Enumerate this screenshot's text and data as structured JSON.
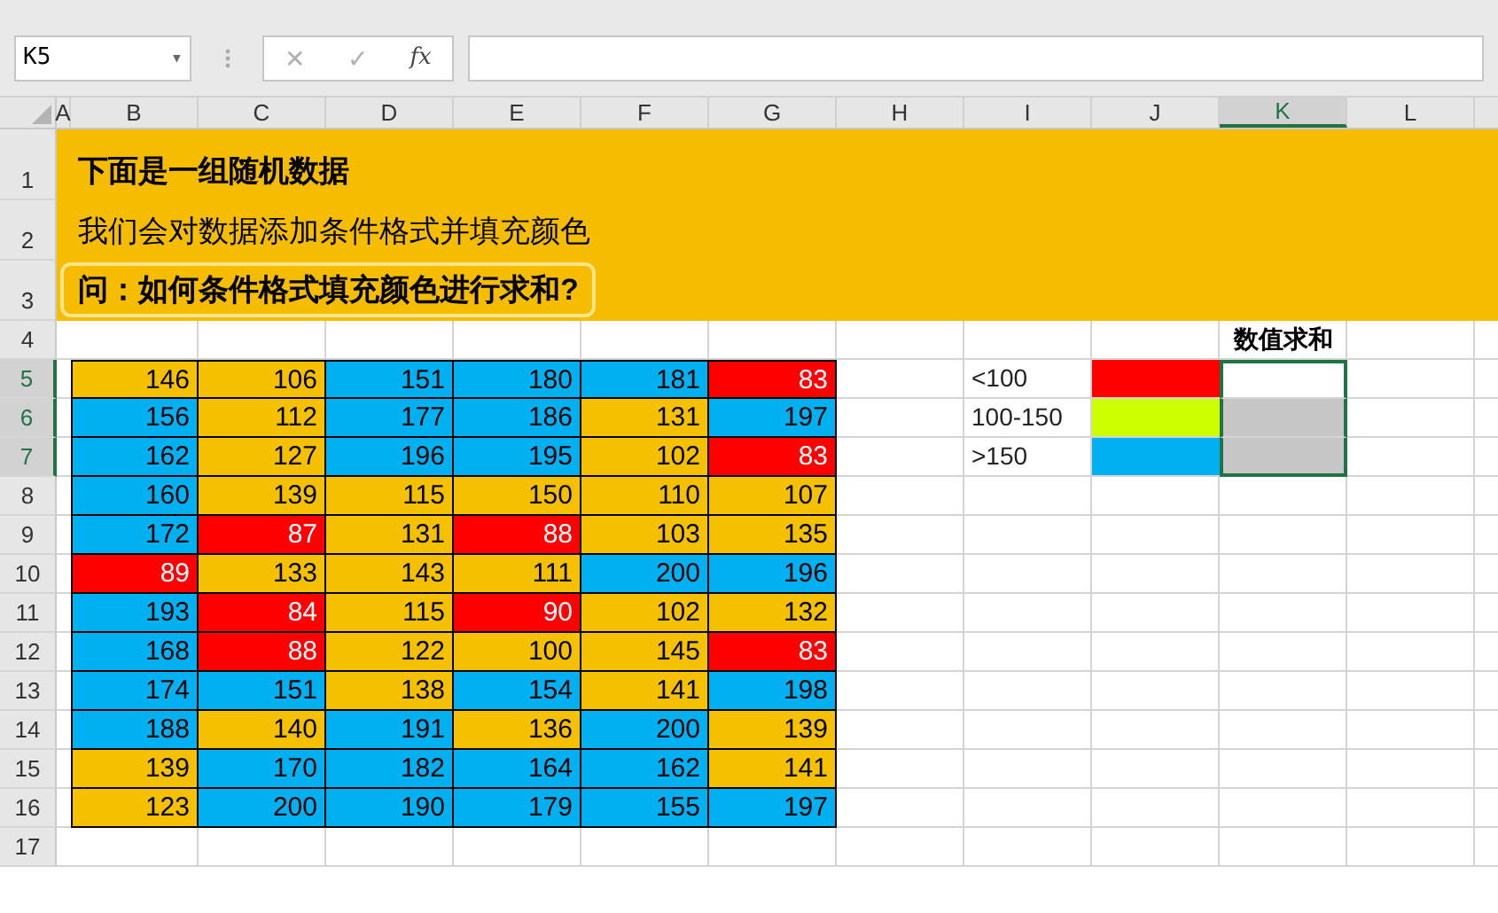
{
  "name_box": {
    "value": "K5",
    "caret": "▾"
  },
  "formula_bar": {
    "cancel": "✕",
    "enter": "✓",
    "function": "fx"
  },
  "columns": [
    {
      "label": "A",
      "selected": false
    },
    {
      "label": "B",
      "selected": false
    },
    {
      "label": "C",
      "selected": false
    },
    {
      "label": "D",
      "selected": false
    },
    {
      "label": "E",
      "selected": false
    },
    {
      "label": "F",
      "selected": false
    },
    {
      "label": "G",
      "selected": false
    },
    {
      "label": "H",
      "selected": false
    },
    {
      "label": "I",
      "selected": false
    },
    {
      "label": "J",
      "selected": false
    },
    {
      "label": "K",
      "selected": true
    },
    {
      "label": "L",
      "selected": false
    }
  ],
  "row_numbers": [
    {
      "label": "1",
      "selected": false
    },
    {
      "label": "2",
      "selected": false
    },
    {
      "label": "3",
      "selected": false
    },
    {
      "label": "4",
      "selected": false
    },
    {
      "label": "5",
      "selected": true
    },
    {
      "label": "6",
      "selected": true
    },
    {
      "label": "7",
      "selected": true
    },
    {
      "label": "8",
      "selected": false
    },
    {
      "label": "9",
      "selected": false
    },
    {
      "label": "10",
      "selected": false
    },
    {
      "label": "11",
      "selected": false
    },
    {
      "label": "12",
      "selected": false
    },
    {
      "label": "13",
      "selected": false
    },
    {
      "label": "14",
      "selected": false
    },
    {
      "label": "15",
      "selected": false
    },
    {
      "label": "16",
      "selected": false
    },
    {
      "label": "17",
      "selected": false
    }
  ],
  "banner": [
    {
      "kind": "title",
      "text": "下面是一组随机数据"
    },
    {
      "kind": "text",
      "text": "我们会对数据添加条件格式并填充颜色"
    },
    {
      "kind": "question",
      "text": "问：如何条件格式填充颜色进行求和?"
    }
  ],
  "data_rows": [
    [
      {
        "value": "146",
        "color": "#f5c000"
      },
      {
        "value": "106",
        "color": "#f5c000"
      },
      {
        "value": "151",
        "color": "#00b0f0"
      },
      {
        "value": "180",
        "color": "#00b0f0"
      },
      {
        "value": "181",
        "color": "#00b0f0"
      },
      {
        "value": "83",
        "color": "#ff0000"
      }
    ],
    [
      {
        "value": "156",
        "color": "#00b0f0"
      },
      {
        "value": "112",
        "color": "#f5c000"
      },
      {
        "value": "177",
        "color": "#00b0f0"
      },
      {
        "value": "186",
        "color": "#00b0f0"
      },
      {
        "value": "131",
        "color": "#f5c000"
      },
      {
        "value": "197",
        "color": "#00b0f0"
      }
    ],
    [
      {
        "value": "162",
        "color": "#00b0f0"
      },
      {
        "value": "127",
        "color": "#f5c000"
      },
      {
        "value": "196",
        "color": "#00b0f0"
      },
      {
        "value": "195",
        "color": "#00b0f0"
      },
      {
        "value": "102",
        "color": "#f5c000"
      },
      {
        "value": "83",
        "color": "#ff0000"
      }
    ],
    [
      {
        "value": "160",
        "color": "#00b0f0"
      },
      {
        "value": "139",
        "color": "#f5c000"
      },
      {
        "value": "115",
        "color": "#f5c000"
      },
      {
        "value": "150",
        "color": "#f5c000"
      },
      {
        "value": "110",
        "color": "#f5c000"
      },
      {
        "value": "107",
        "color": "#f5c000"
      }
    ],
    [
      {
        "value": "172",
        "color": "#00b0f0"
      },
      {
        "value": "87",
        "color": "#ff0000"
      },
      {
        "value": "131",
        "color": "#f5c000"
      },
      {
        "value": "88",
        "color": "#ff0000"
      },
      {
        "value": "103",
        "color": "#f5c000"
      },
      {
        "value": "135",
        "color": "#f5c000"
      }
    ],
    [
      {
        "value": "89",
        "color": "#ff0000"
      },
      {
        "value": "133",
        "color": "#f5c000"
      },
      {
        "value": "143",
        "color": "#f5c000"
      },
      {
        "value": "111",
        "color": "#f5c000"
      },
      {
        "value": "200",
        "color": "#00b0f0"
      },
      {
        "value": "196",
        "color": "#00b0f0"
      }
    ],
    [
      {
        "value": "193",
        "color": "#00b0f0"
      },
      {
        "value": "84",
        "color": "#ff0000"
      },
      {
        "value": "115",
        "color": "#f5c000"
      },
      {
        "value": "90",
        "color": "#ff0000"
      },
      {
        "value": "102",
        "color": "#f5c000"
      },
      {
        "value": "132",
        "color": "#f5c000"
      }
    ],
    [
      {
        "value": "168",
        "color": "#00b0f0"
      },
      {
        "value": "88",
        "color": "#ff0000"
      },
      {
        "value": "122",
        "color": "#f5c000"
      },
      {
        "value": "100",
        "color": "#f5c000"
      },
      {
        "value": "145",
        "color": "#f5c000"
      },
      {
        "value": "83",
        "color": "#ff0000"
      }
    ],
    [
      {
        "value": "174",
        "color": "#00b0f0"
      },
      {
        "value": "151",
        "color": "#00b0f0"
      },
      {
        "value": "138",
        "color": "#f5c000"
      },
      {
        "value": "154",
        "color": "#00b0f0"
      },
      {
        "value": "141",
        "color": "#f5c000"
      },
      {
        "value": "198",
        "color": "#00b0f0"
      }
    ],
    [
      {
        "value": "188",
        "color": "#00b0f0"
      },
      {
        "value": "140",
        "color": "#f5c000"
      },
      {
        "value": "191",
        "color": "#00b0f0"
      },
      {
        "value": "136",
        "color": "#f5c000"
      },
      {
        "value": "200",
        "color": "#00b0f0"
      },
      {
        "value": "139",
        "color": "#f5c000"
      }
    ],
    [
      {
        "value": "139",
        "color": "#f5c000"
      },
      {
        "value": "170",
        "color": "#00b0f0"
      },
      {
        "value": "182",
        "color": "#00b0f0"
      },
      {
        "value": "164",
        "color": "#00b0f0"
      },
      {
        "value": "162",
        "color": "#00b0f0"
      },
      {
        "value": "141",
        "color": "#f5c000"
      }
    ],
    [
      {
        "value": "123",
        "color": "#f5c000"
      },
      {
        "value": "200",
        "color": "#00b0f0"
      },
      {
        "value": "190",
        "color": "#00b0f0"
      },
      {
        "value": "179",
        "color": "#00b0f0"
      },
      {
        "value": "155",
        "color": "#00b0f0"
      },
      {
        "value": "197",
        "color": "#00b0f0"
      }
    ]
  ],
  "legend": {
    "header": "数值求和",
    "items": [
      {
        "label": "<100",
        "color": "#ff0000",
        "selected": true,
        "active": true
      },
      {
        "label": "100-150",
        "color": "#ccff00",
        "selected": true,
        "active": false
      },
      {
        "label": ">150",
        "color": "#00b0f0",
        "selected": true,
        "active": false
      }
    ]
  }
}
